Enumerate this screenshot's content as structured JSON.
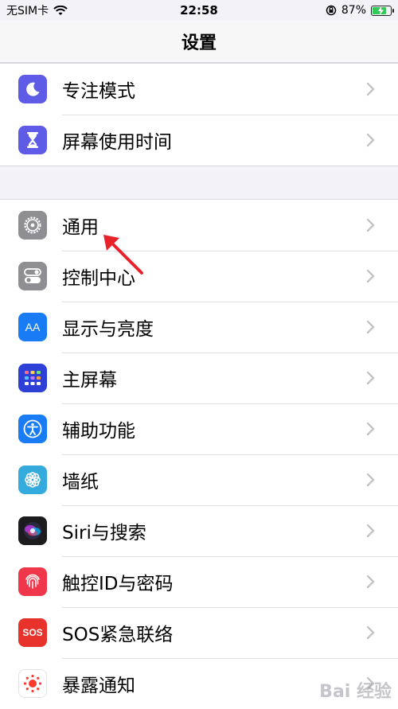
{
  "status": {
    "carrier": "无SIM卡",
    "time": "22:58",
    "battery": "87%"
  },
  "nav": {
    "title": "设置"
  },
  "group1": [
    {
      "label": "专注模式",
      "icon": "moon-icon",
      "color": "#5e5ce6"
    },
    {
      "label": "屏幕使用时间",
      "icon": "hourglass-icon",
      "color": "#5e5ce6"
    }
  ],
  "group2": [
    {
      "label": "通用",
      "icon": "gear-icon",
      "color": "#8e8e93"
    },
    {
      "label": "控制中心",
      "icon": "toggles-icon",
      "color": "#8e8e93"
    },
    {
      "label": "显示与亮度",
      "icon": "text-size-icon",
      "color": "#1a7cf5"
    },
    {
      "label": "主屏幕",
      "icon": "home-grid-icon",
      "color": "#2d3fd6"
    },
    {
      "label": "辅助功能",
      "icon": "accessibility-icon",
      "color": "#1a7cf5"
    },
    {
      "label": "墙纸",
      "icon": "flower-icon",
      "color": "#35aadc"
    },
    {
      "label": "Siri与搜索",
      "icon": "siri-icon",
      "color": "#1c1c1e"
    },
    {
      "label": "触控ID与密码",
      "icon": "fingerprint-icon",
      "color": "#f0364a"
    },
    {
      "label": "SOS紧急联络",
      "icon": "sos-icon",
      "color": "#e8322c"
    },
    {
      "label": "暴露通知",
      "icon": "exposure-icon",
      "color": "#ffffff"
    }
  ],
  "icons_text": {
    "text_size": "AA",
    "sos": "SOS"
  },
  "watermark": "Bai 经验"
}
